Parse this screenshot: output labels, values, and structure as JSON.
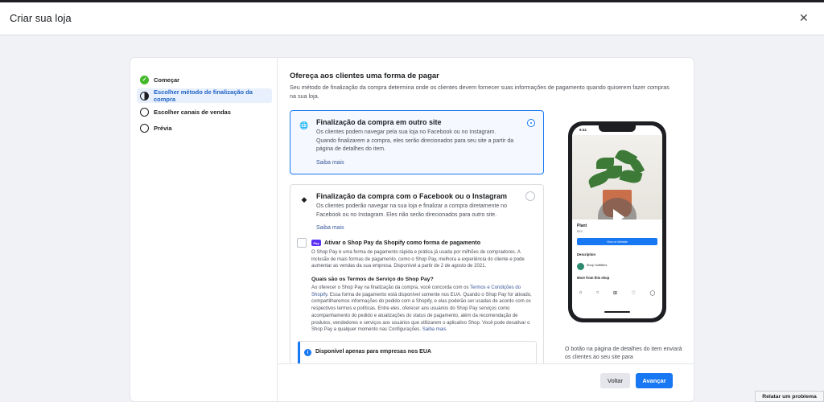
{
  "header": {
    "title": "Criar sua loja",
    "close_icon": "close-icon"
  },
  "sidebar": {
    "steps": [
      {
        "label": "Começar",
        "state": "done"
      },
      {
        "label": "Escolher método de finalização da compra",
        "state": "current"
      },
      {
        "label": "Escolher canais de vendas",
        "state": "todo"
      },
      {
        "label": "Prévia",
        "state": "todo"
      }
    ]
  },
  "main": {
    "title": "Ofereça aos clientes uma forma de pagar",
    "description": "Seu método de finalização da compra determina onde os clientes devem fornecer suas informações de pagamento quando quiserem fazer compras na sua loja.",
    "options": [
      {
        "title": "Finalização da compra em outro site",
        "description": "Os clientes podem navegar pela sua loja no Facebook ou no Instagram. Quando finalizarem a compra, eles serão direcionados para seu site a partir da página de detalhes do item.",
        "link": "Saiba mais",
        "icon": "globe-icon",
        "selected": true
      },
      {
        "title": "Finalização da compra com o Facebook ou o Instagram",
        "description": "Os clientes poderão navegar na sua loja e finalizar a compra diretamente no Facebook ou no Instagram. Eles não serão direcionados para outro site.",
        "link": "Saiba mais",
        "icon": "tag-icon",
        "selected": false
      }
    ],
    "shoppay": {
      "badge": "Pay",
      "title": "Ativar o Shop Pay da Shopify como forma de pagamento",
      "text": "O Shop Pay é uma forma de pagamento rápida e prática já usada por milhões de compradores. A inclusão de mais formas de pagamento, como o Shop Pay, melhora a experiência do cliente e pode aumentar as vendas da sua empresa. Disponível a partir de 2 de agosto de 2021.",
      "terms_title": "Quais são os Termos de Serviço do Shop Pay?",
      "terms_pre": "Ao oferecer o Shop Pay na finalização da compra, você concorda com os ",
      "terms_link": "Termos e Condições do Shopify",
      "terms_post": ". Essa forma de pagamento está disponível somente nos EUA. Quando o Shop Pay for ativado, compartilharemos informações do pedido com a Shopify, e elas poderão ser usadas de acordo com os respectivos termos e políticas. Entre eles, oferecer aos usuários do Shop Pay serviços como acompanhamento do pedido e atualizações do status de pagamento, além da recomendação de produtos, vendedores e serviços aos usuários que utilizarem o aplicativo Shop. Você pode desativar o Shop Pay a qualquer momento nas Configurações. ",
      "terms_more": "Saiba mais"
    },
    "info": {
      "text": "Disponível apenas para empresas nos EUA",
      "icon": "info-icon"
    }
  },
  "preview": {
    "time": "9:41",
    "product_name": "Plant",
    "product_price": "$15",
    "cta": "View on Website",
    "description_label": "Description",
    "shop_name": "Shop Outfitters",
    "more_label": "More from this shop",
    "note": "O botão na página de detalhes do item enviará os clientes ao seu site para"
  },
  "footer": {
    "back_label": "Voltar",
    "next_label": "Avançar"
  },
  "report": {
    "label": "Relatar um problema"
  },
  "colors": {
    "accent": "#1877f2",
    "done": "#42b72a",
    "active_bg": "#e7f0fc"
  }
}
